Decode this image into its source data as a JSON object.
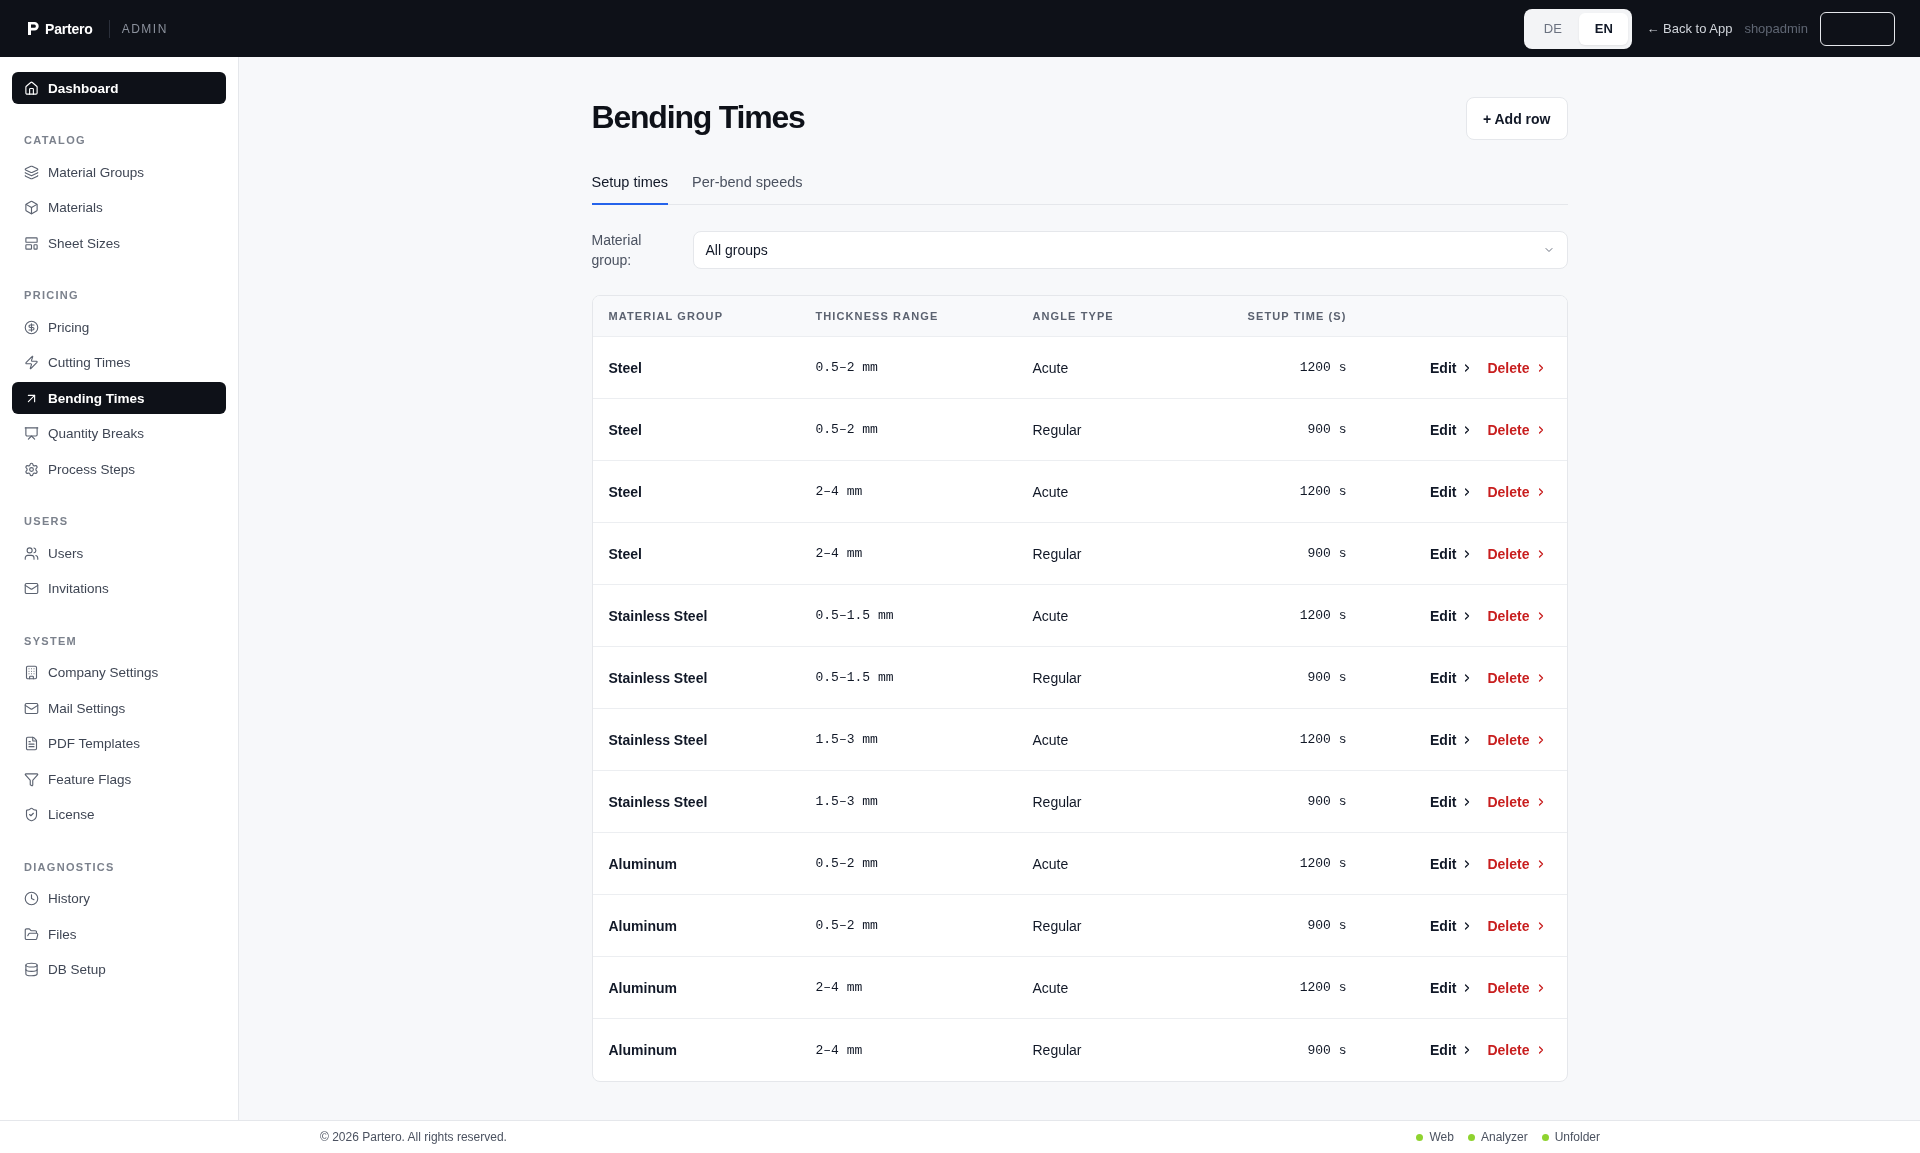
{
  "header": {
    "brand": "Partero",
    "area": "ADMIN",
    "languages": [
      {
        "label": "DE",
        "selected": false
      },
      {
        "label": "EN",
        "selected": true
      }
    ],
    "back_link": "← Back to App",
    "username": "shopadmin"
  },
  "sidebar": {
    "items": [
      {
        "label": "Dashboard",
        "selected": true
      }
    ],
    "sections": [
      {
        "title": "CATALOG",
        "items": [
          {
            "label": "Material Groups",
            "selected": false
          },
          {
            "label": "Materials",
            "selected": false
          },
          {
            "label": "Sheet Sizes",
            "selected": false
          }
        ]
      },
      {
        "title": "PRICING",
        "items": [
          {
            "label": "Pricing",
            "selected": false
          },
          {
            "label": "Cutting Times",
            "selected": false
          },
          {
            "label": "Bending Times",
            "selected": true
          },
          {
            "label": "Quantity Breaks",
            "selected": false
          },
          {
            "label": "Process Steps",
            "selected": false
          }
        ]
      },
      {
        "title": "USERS",
        "items": [
          {
            "label": "Users",
            "selected": false
          },
          {
            "label": "Invitations",
            "selected": false
          }
        ]
      },
      {
        "title": "SYSTEM",
        "items": [
          {
            "label": "Company Settings",
            "selected": false
          },
          {
            "label": "Mail Settings",
            "selected": false
          },
          {
            "label": "PDF Templates",
            "selected": false
          },
          {
            "label": "Feature Flags",
            "selected": false
          },
          {
            "label": "License",
            "selected": false
          }
        ]
      },
      {
        "title": "DIAGNOSTICS",
        "items": [
          {
            "label": "History",
            "selected": false
          },
          {
            "label": "Files",
            "selected": false
          },
          {
            "label": "DB Setup",
            "selected": false
          }
        ]
      }
    ]
  },
  "page": {
    "title": "Bending Times",
    "add_button": "+ Add row",
    "tabs": [
      {
        "label": "Setup times",
        "selected": true
      },
      {
        "label": "Per-bend speeds",
        "selected": false
      }
    ],
    "filter": {
      "label": "Material group:",
      "value": "All groups"
    }
  },
  "table": {
    "columns": [
      "MATERIAL GROUP",
      "THICKNESS RANGE",
      "ANGLE TYPE",
      "SETUP TIME (S)"
    ],
    "rows": [
      {
        "material_group": "Steel",
        "thickness_range": "0.5–2 mm",
        "angle_type": "Acute",
        "setup_time": "1200 s",
        "actions": [
          {
            "label": "Edit",
            "kind": "edit"
          },
          {
            "label": "Delete",
            "kind": "delete"
          }
        ]
      },
      {
        "material_group": "Steel",
        "thickness_range": "0.5–2 mm",
        "angle_type": "Regular",
        "setup_time": "900 s",
        "actions": [
          {
            "label": "Edit",
            "kind": "edit"
          },
          {
            "label": "Delete",
            "kind": "delete"
          }
        ]
      },
      {
        "material_group": "Steel",
        "thickness_range": "2–4 mm",
        "angle_type": "Acute",
        "setup_time": "1200 s",
        "actions": [
          {
            "label": "Edit",
            "kind": "edit"
          },
          {
            "label": "Delete",
            "kind": "delete"
          }
        ]
      },
      {
        "material_group": "Steel",
        "thickness_range": "2–4 mm",
        "angle_type": "Regular",
        "setup_time": "900 s",
        "actions": [
          {
            "label": "Edit",
            "kind": "edit"
          },
          {
            "label": "Delete",
            "kind": "delete"
          }
        ]
      },
      {
        "material_group": "Stainless Steel",
        "thickness_range": "0.5–1.5 mm",
        "angle_type": "Acute",
        "setup_time": "1200 s",
        "actions": [
          {
            "label": "Edit",
            "kind": "edit"
          },
          {
            "label": "Delete",
            "kind": "delete"
          }
        ]
      },
      {
        "material_group": "Stainless Steel",
        "thickness_range": "0.5–1.5 mm",
        "angle_type": "Regular",
        "setup_time": "900 s",
        "actions": [
          {
            "label": "Edit",
            "kind": "edit"
          },
          {
            "label": "Delete",
            "kind": "delete"
          }
        ]
      },
      {
        "material_group": "Stainless Steel",
        "thickness_range": "1.5–3 mm",
        "angle_type": "Acute",
        "setup_time": "1200 s",
        "actions": [
          {
            "label": "Edit",
            "kind": "edit"
          },
          {
            "label": "Delete",
            "kind": "delete"
          }
        ]
      },
      {
        "material_group": "Stainless Steel",
        "thickness_range": "1.5–3 mm",
        "angle_type": "Regular",
        "setup_time": "900 s",
        "actions": [
          {
            "label": "Edit",
            "kind": "edit"
          },
          {
            "label": "Delete",
            "kind": "delete"
          }
        ]
      },
      {
        "material_group": "Aluminum",
        "thickness_range": "0.5–2 mm",
        "angle_type": "Acute",
        "setup_time": "1200 s",
        "actions": [
          {
            "label": "Edit",
            "kind": "edit"
          },
          {
            "label": "Delete",
            "kind": "delete"
          }
        ]
      },
      {
        "material_group": "Aluminum",
        "thickness_range": "0.5–2 mm",
        "angle_type": "Regular",
        "setup_time": "900 s",
        "actions": [
          {
            "label": "Edit",
            "kind": "edit"
          },
          {
            "label": "Delete",
            "kind": "delete"
          }
        ]
      },
      {
        "material_group": "Aluminum",
        "thickness_range": "2–4 mm",
        "angle_type": "Acute",
        "setup_time": "1200 s",
        "actions": [
          {
            "label": "Edit",
            "kind": "edit"
          },
          {
            "label": "Delete",
            "kind": "delete"
          }
        ]
      },
      {
        "material_group": "Aluminum",
        "thickness_range": "2–4 mm",
        "angle_type": "Regular",
        "setup_time": "900 s",
        "actions": [
          {
            "label": "Edit",
            "kind": "edit"
          },
          {
            "label": "Delete",
            "kind": "delete"
          }
        ]
      }
    ]
  },
  "footer": {
    "copyright": "© 2026 Partero. All rights reserved.",
    "services": [
      {
        "label": "Web",
        "online": true
      },
      {
        "label": "Analyzer",
        "online": true
      },
      {
        "label": "Unfolder",
        "online": true
      }
    ]
  }
}
